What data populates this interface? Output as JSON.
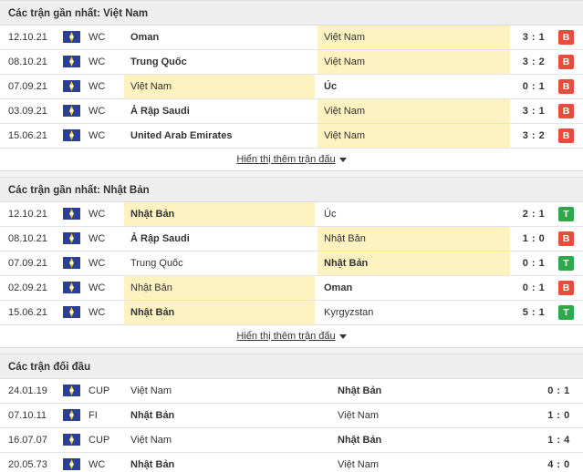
{
  "sections": [
    {
      "title": "Các trận gần nhất: Việt Nam",
      "more_label": "Hiển thị thêm trận đấu",
      "rows": [
        {
          "date": "12.10.21",
          "comp": "WC",
          "home": "Oman",
          "away": "Việt Nam",
          "score": "3 : 1",
          "result": "B",
          "hl": "away",
          "bold": "home"
        },
        {
          "date": "08.10.21",
          "comp": "WC",
          "home": "Trung Quốc",
          "away": "Việt Nam",
          "score": "3 : 2",
          "result": "B",
          "hl": "away",
          "bold": "home"
        },
        {
          "date": "07.09.21",
          "comp": "WC",
          "home": "Việt Nam",
          "away": "Úc",
          "score": "0 : 1",
          "result": "B",
          "hl": "home",
          "bold": "away"
        },
        {
          "date": "03.09.21",
          "comp": "WC",
          "home": "Ả Rập Saudi",
          "away": "Việt Nam",
          "score": "3 : 1",
          "result": "B",
          "hl": "away",
          "bold": "home"
        },
        {
          "date": "15.06.21",
          "comp": "WC",
          "home": "United Arab Emirates",
          "away": "Việt Nam",
          "score": "3 : 2",
          "result": "B",
          "hl": "away",
          "bold": "home"
        }
      ]
    },
    {
      "title": "Các trận gần nhất: Nhật Bản",
      "more_label": "Hiển thị thêm trận đấu",
      "rows": [
        {
          "date": "12.10.21",
          "comp": "WC",
          "home": "Nhật Bản",
          "away": "Úc",
          "score": "2 : 1",
          "result": "T",
          "hl": "home",
          "bold": "home"
        },
        {
          "date": "08.10.21",
          "comp": "WC",
          "home": "Ả Rập Saudi",
          "away": "Nhật Bản",
          "score": "1 : 0",
          "result": "B",
          "hl": "away",
          "bold": "home"
        },
        {
          "date": "07.09.21",
          "comp": "WC",
          "home": "Trung Quốc",
          "away": "Nhật Bản",
          "score": "0 : 1",
          "result": "T",
          "hl": "away",
          "bold": "away"
        },
        {
          "date": "02.09.21",
          "comp": "WC",
          "home": "Nhật Bản",
          "away": "Oman",
          "score": "0 : 1",
          "result": "B",
          "hl": "home",
          "bold": "away"
        },
        {
          "date": "15.06.21",
          "comp": "WC",
          "home": "Nhật Bản",
          "away": "Kyrgyzstan",
          "score": "5 : 1",
          "result": "T",
          "hl": "home",
          "bold": "home"
        }
      ]
    }
  ],
  "h2h": {
    "title": "Các trận đối đầu",
    "rows": [
      {
        "date": "24.01.19",
        "comp": "CUP",
        "home": "Việt Nam",
        "away": "Nhật Bản",
        "score": "0 : 1",
        "bold": "away"
      },
      {
        "date": "07.10.11",
        "comp": "FI",
        "home": "Nhật Bản",
        "away": "Việt Nam",
        "score": "1 : 0",
        "bold": "home"
      },
      {
        "date": "16.07.07",
        "comp": "CUP",
        "home": "Việt Nam",
        "away": "Nhật Bản",
        "score": "1 : 4",
        "bold": "away"
      },
      {
        "date": "20.05.73",
        "comp": "WC",
        "home": "Nhật Bản",
        "away": "Việt Nam",
        "score": "4 : 0",
        "bold": "home"
      }
    ]
  },
  "icons": {
    "competition_flag": "league-flag-icon",
    "expand": "caret-down-icon"
  },
  "colors": {
    "loss": "#e74c3c",
    "win": "#2ea84a",
    "highlight": "#fdf2c0",
    "header_bg": "#eeeeee"
  }
}
